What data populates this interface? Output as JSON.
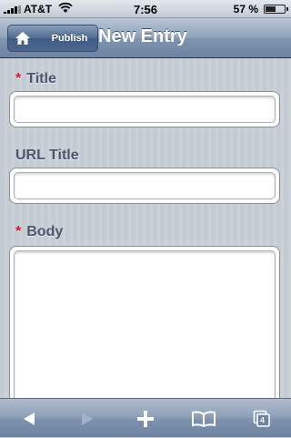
{
  "status_bar": {
    "carrier": "AT&T",
    "time": "7:56",
    "battery_percent": "57 %",
    "battery_level": 0.57
  },
  "nav": {
    "back_label": "Publish",
    "title": "New Entry"
  },
  "form": {
    "fields": [
      {
        "label": "Title",
        "required": true,
        "required_mark": "*",
        "value": ""
      },
      {
        "label": "URL Title",
        "required": false,
        "value": ""
      },
      {
        "label": "Body",
        "required": true,
        "required_mark": "*",
        "value": ""
      }
    ]
  },
  "toolbar": {
    "tabs_count": "4",
    "buttons": [
      "back-icon",
      "forward-icon",
      "add-icon",
      "bookmarks-icon",
      "tabs-icon"
    ]
  },
  "colors": {
    "required": "#c0232d",
    "label": "#4c566c",
    "nav_gradient_top": "#b9c6d6",
    "nav_gradient_bottom": "#6d84a2"
  }
}
